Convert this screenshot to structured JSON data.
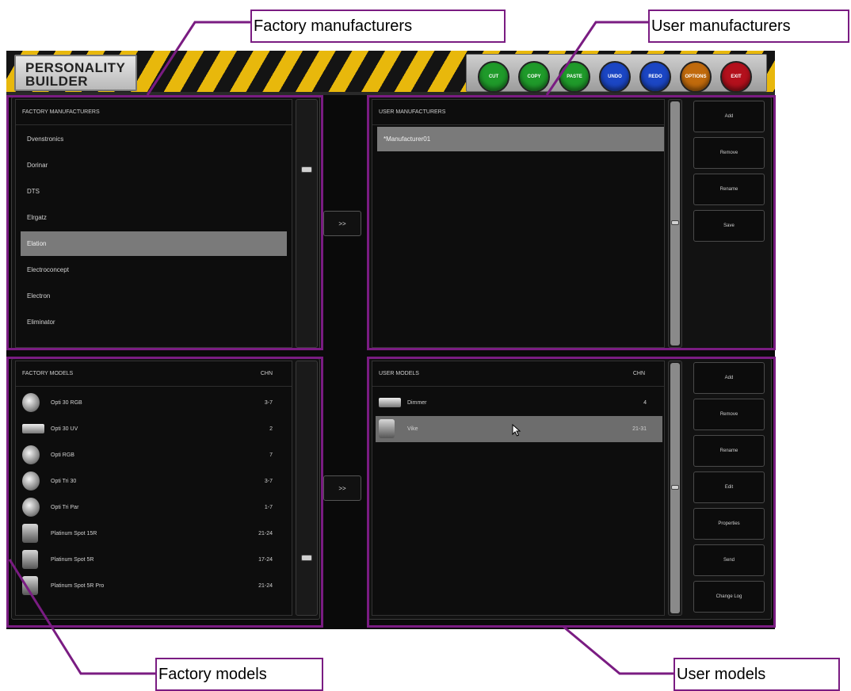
{
  "app": {
    "logo": {
      "line1": "PERSONALITY",
      "line2": "BUILDER"
    },
    "toolbar": [
      {
        "label": "CUT",
        "color": "#1f9a2a"
      },
      {
        "label": "COPY",
        "color": "#1f9a2a"
      },
      {
        "label": "PASTE",
        "color": "#1f9a2a"
      },
      {
        "label": "UNDO",
        "color": "#1b46c4"
      },
      {
        "label": "REDO",
        "color": "#1b46c4"
      },
      {
        "label": "OPTIONS",
        "color": "#c06a0c"
      },
      {
        "label": "EXIT",
        "color": "#b3101c"
      }
    ]
  },
  "factory_manufacturers": {
    "header": "FACTORY MANUFACTURERS",
    "items": [
      "Dvenstronics",
      "Dorinar",
      "DTS",
      "Elrgatz",
      "Elation",
      "Electroconcept",
      "Electron",
      "Eliminator"
    ],
    "selected_index": 4
  },
  "user_manufacturers": {
    "header": "USER MANUFACTURERS",
    "items": [
      "*Manufacturer01"
    ],
    "selected_index": 0,
    "buttons": [
      "Add",
      "Remove",
      "Rename",
      "Save"
    ]
  },
  "factory_models": {
    "header": "FACTORY MODELS",
    "chn_header": "CHN",
    "rows": [
      {
        "name": "Opti 30 RGB",
        "chn": "3-7",
        "icon": "light-fixture-icon"
      },
      {
        "name": "Opti 30 UV",
        "chn": "2",
        "icon": "flat-panel-icon"
      },
      {
        "name": "Opti RGB",
        "chn": "7",
        "icon": "light-fixture-icon"
      },
      {
        "name": "Opti Tri 30",
        "chn": "3-7",
        "icon": "light-fixture-icon"
      },
      {
        "name": "Opti Tri Par",
        "chn": "1-7",
        "icon": "light-fixture-icon"
      },
      {
        "name": "Platinum Spot 15R",
        "chn": "21-24",
        "icon": "moving-head-icon"
      },
      {
        "name": "Platinum Spot 5R",
        "chn": "17-24",
        "icon": "moving-head-icon"
      },
      {
        "name": "Platinum Spot 5R Pro",
        "chn": "21-24",
        "icon": "moving-head-icon"
      }
    ]
  },
  "user_models": {
    "header": "USER MODELS",
    "chn_header": "CHN",
    "rows": [
      {
        "name": "Dimmer",
        "chn": "4",
        "icon": "flat-panel-icon"
      },
      {
        "name": "Vike",
        "chn": "21-31",
        "icon": "moving-head-icon"
      }
    ],
    "selected_index": 1,
    "buttons": [
      "Add",
      "Remove",
      "Rename",
      "Edit",
      "Properties",
      "Send",
      "Change Log"
    ]
  },
  "transfer_buttons": {
    "manufacturers": ">>",
    "models": ">>"
  },
  "annotations": {
    "factory_manufacturers": "Factory manufacturers",
    "user_manufacturers": "User manufacturers",
    "factory_models": "Factory models",
    "user_models": "User models"
  }
}
